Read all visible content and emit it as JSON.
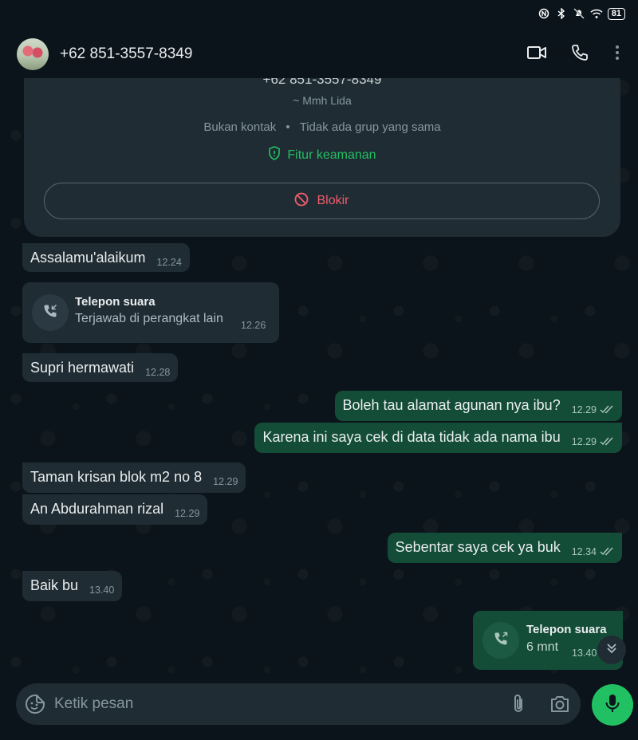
{
  "status_bar": {
    "battery": "81"
  },
  "header": {
    "contact_name": "+62 851-3557-8349"
  },
  "info_card": {
    "phone": "+62 851-3557-8349",
    "alias": "~ Mmh Lida",
    "meta_left": "Bukan kontak",
    "meta_sep": "•",
    "meta_right": "Tidak ada grup yang sama",
    "security_label": "Fitur keamanan",
    "block_label": "Blokir"
  },
  "messages": [
    {
      "direction": "in",
      "text": "Assalamu'alaikum",
      "time": "12.24"
    },
    {
      "direction": "in",
      "type": "call",
      "title": "Telepon suara",
      "subtitle": "Terjawab di perangkat lain",
      "time": "12.26"
    },
    {
      "direction": "in",
      "text": "Supri hermawati",
      "time": "12.28"
    },
    {
      "direction": "out",
      "text": "Boleh tau alamat agunan nya ibu?",
      "time": "12.29",
      "status": "read"
    },
    {
      "direction": "out",
      "text": "Karena ini saya cek di data tidak ada nama ibu",
      "time": "12.29",
      "status": "read"
    },
    {
      "direction": "in",
      "text": "Taman krisan blok m2 no 8",
      "time": "12.29"
    },
    {
      "direction": "in",
      "text": "An Abdurahman rizal",
      "time": "12.29"
    },
    {
      "direction": "out",
      "text": "Sebentar saya cek ya buk",
      "time": "12.34",
      "status": "read"
    },
    {
      "direction": "in",
      "text": "Baik bu",
      "time": "13.40"
    },
    {
      "direction": "out",
      "type": "call",
      "title": "Telepon suara",
      "subtitle": "6 mnt",
      "time": "13.40"
    }
  ],
  "composer": {
    "placeholder": "Ketik pesan"
  },
  "colors": {
    "background": "#0b141a",
    "incoming_bubble": "#1f2c33",
    "outgoing_bubble": "#144d37",
    "accent_green": "#21c063",
    "danger_red": "#f15c6d"
  },
  "icons": [
    "video-call-icon",
    "voice-call-icon",
    "more-options-icon",
    "shield-icon",
    "block-icon",
    "call-received-icon",
    "call-outgoing-icon",
    "read-ticks-icon",
    "chevron-down-icon",
    "sticker-icon",
    "attach-icon",
    "camera-icon",
    "mic-icon"
  ]
}
